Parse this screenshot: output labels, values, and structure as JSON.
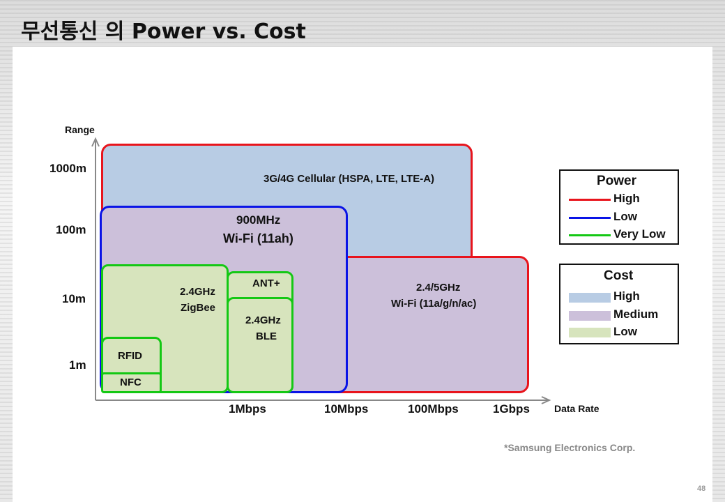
{
  "title": "무선통신 의 Power vs. Cost",
  "axes": {
    "y_label": "Range",
    "x_label": "Data Rate",
    "y_ticks": [
      "1000m",
      "100m",
      "10m",
      "1m"
    ],
    "x_ticks": [
      "1Mbps",
      "10Mbps",
      "100Mbps",
      "1Gbps"
    ]
  },
  "technologies": {
    "cellular": "3G/4G Cellular (HSPA, LTE, LTE-A)",
    "wifi_ah_line1": "900MHz",
    "wifi_ah_line2": "Wi-Fi (11ah)",
    "wifi_ac_line1": "2.4/5GHz",
    "wifi_ac_line2": "Wi-Fi (11a/g/n/ac)",
    "zigbee_line1": "2.4GHz",
    "zigbee_line2": "ZigBee",
    "ant": "ANT+",
    "ble_line1": "2.4GHz",
    "ble_line2": "BLE",
    "rfid": "RFID",
    "nfc": "NFC"
  },
  "legend_power": {
    "title": "Power",
    "items": [
      {
        "label": "High",
        "color": "#e8141c"
      },
      {
        "label": "Low",
        "color": "#0a14e6"
      },
      {
        "label": "Very Low",
        "color": "#14c814"
      }
    ]
  },
  "legend_cost": {
    "title": "Cost",
    "items": [
      {
        "label": "High",
        "color": "#b8cce4"
      },
      {
        "label": "Medium",
        "color": "#ccc0da"
      },
      {
        "label": "Low",
        "color": "#d7e4bd"
      }
    ]
  },
  "footnote": "*Samsung Electronics Corp.",
  "page_number": "48"
}
